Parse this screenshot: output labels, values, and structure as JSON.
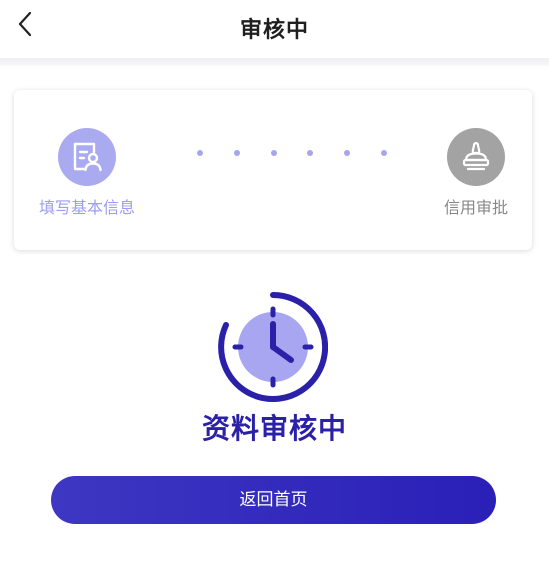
{
  "header": {
    "title": "审核中",
    "back_icon": "chevron-left-icon"
  },
  "steps": [
    {
      "label": "填写基本信息",
      "icon": "profile-form-icon",
      "status": "done",
      "color": "#aaaaf0"
    },
    {
      "label": "信用审批",
      "icon": "stamp-icon",
      "status": "pending",
      "color": "#a3a3a3"
    }
  ],
  "status": {
    "icon": "clock-icon",
    "text": "资料审核中"
  },
  "actions": {
    "home_label": "返回首页"
  },
  "colors": {
    "accent": "#2a21a8",
    "step_active": "#aaaaf0",
    "step_inactive": "#a3a3a3"
  }
}
